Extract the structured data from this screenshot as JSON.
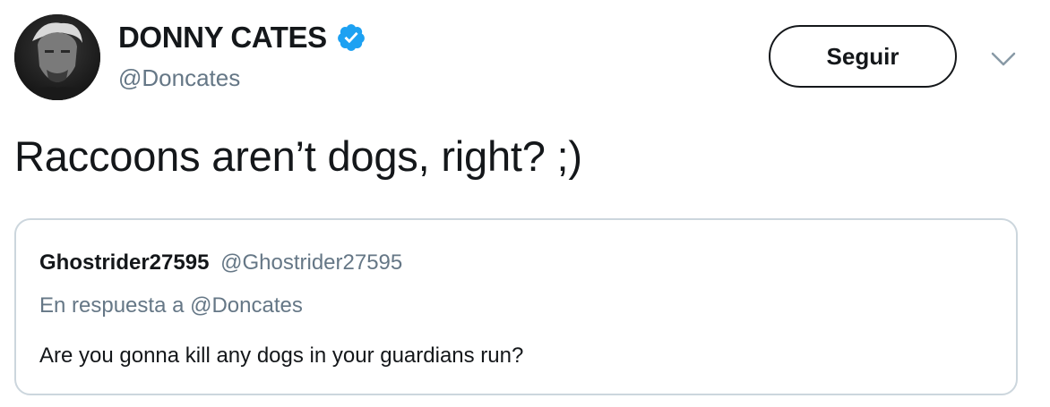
{
  "author": {
    "display_name": "DONNY CATES",
    "handle": "@Doncates",
    "verified": true,
    "avatar": "avatar-photo"
  },
  "actions": {
    "follow_label": "Seguir",
    "more_icon": "chevron-down-icon"
  },
  "tweet": {
    "text": "Raccoons aren’t dogs, right? ;)"
  },
  "quote": {
    "display_name": "Ghostrider27595",
    "handle": "@Ghostrider27595",
    "reply_to": "En respuesta a @Doncates",
    "text": "Are you gonna kill any dogs in your guardians run?"
  },
  "colors": {
    "verified_blue": "#1da1f2",
    "secondary_text": "#657786",
    "border": "#ccd6dd",
    "primary_text": "#14171a"
  }
}
